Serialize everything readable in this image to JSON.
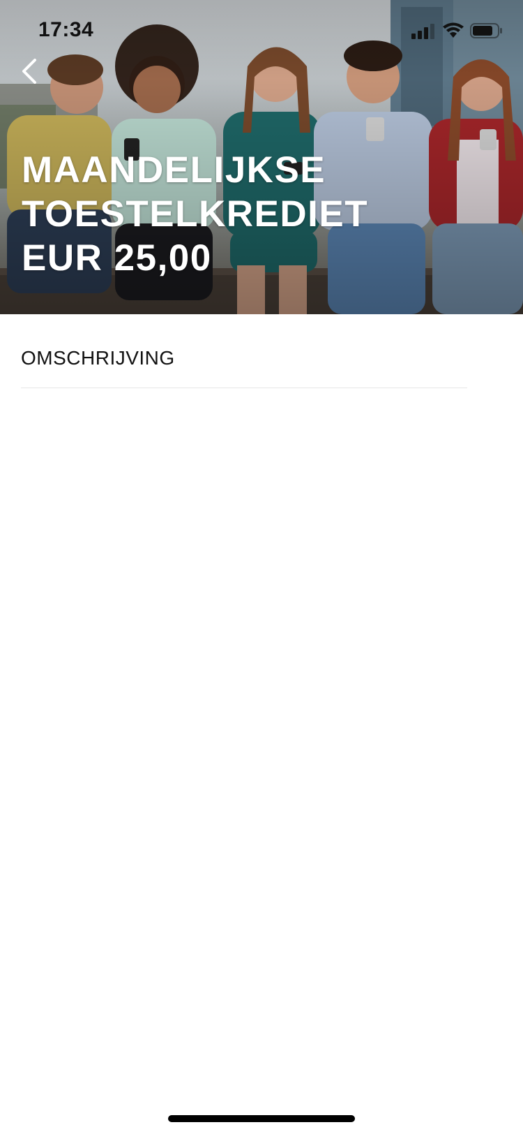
{
  "status_bar": {
    "time": "17:34",
    "icons": [
      "signal-icon",
      "wifi-icon",
      "battery-icon"
    ]
  },
  "hero": {
    "image": "group-of-young-people-with-smartphones-photo",
    "title_lines": [
      "MAANDELIJKSE",
      "TOESTELKREDIET",
      "EUR 25,00"
    ],
    "back_icon": "chevron-left-icon"
  },
  "content": {
    "section_label": "OMSCHRIJVING"
  },
  "colors": {
    "text_primary": "#111111",
    "divider": "#e6e6e6",
    "hero_text": "#ffffff"
  }
}
